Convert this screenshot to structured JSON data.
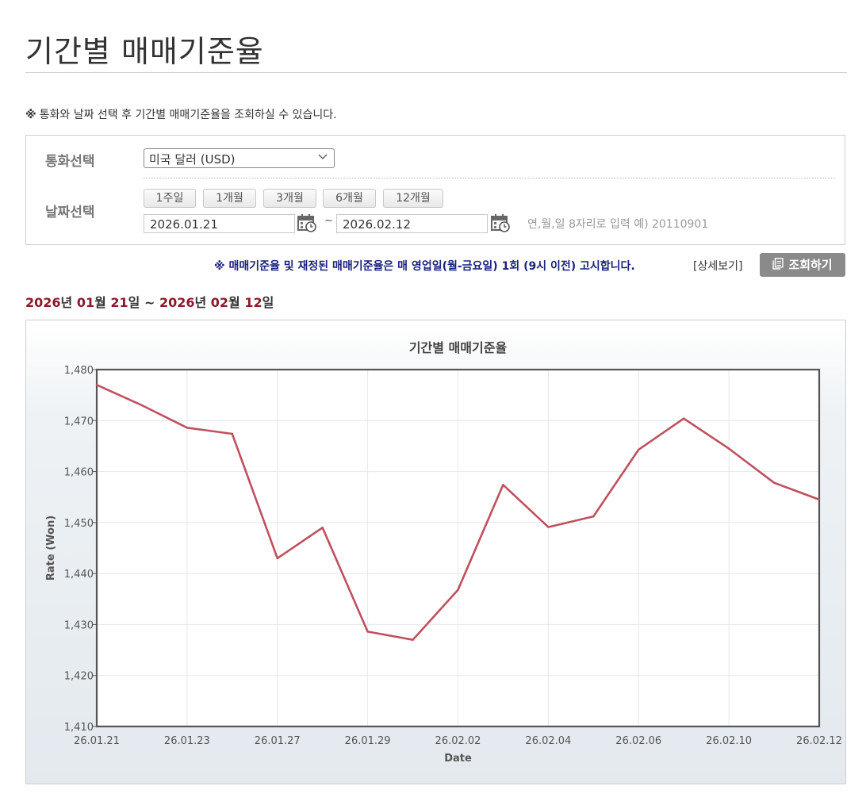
{
  "page": {
    "title": "기간별 매매기준율",
    "notice_mark": "※",
    "notice_text": "통화와 날짜 선택 후 기간별 매매기준율을 조회하실 수 있습니다."
  },
  "search": {
    "currency_label": "통화선택",
    "currency_selected": "미국 달러 (USD)",
    "date_label": "날짜선택",
    "period_buttons": [
      "1주일",
      "1개월",
      "3개월",
      "6개월",
      "12개월"
    ],
    "start_date": "2026.01.21",
    "end_date": "2026.02.12",
    "separator": "~",
    "date_hint": "연,월,일 8자리로 입력 예) 20110901"
  },
  "info": {
    "bold_notice": "※ 매매기준율 및 재정된 매매기준율은 매 영업일(월-금요일) 1회 (9시 이전) 고시합니다.",
    "detail_link": "[상세보기]",
    "search_button": "조회하기"
  },
  "range": {
    "start_year": "2026",
    "start_year_suffix": "년 ",
    "start_month": "01",
    "start_month_suffix": "월 ",
    "start_day": "21",
    "start_day_suffix": "일 ~ ",
    "end_year": "2026",
    "end_year_suffix": "년 ",
    "end_month": "02",
    "end_month_suffix": "월 ",
    "end_day": "12",
    "end_day_suffix": "일"
  },
  "colors": {
    "line": "#c0505e",
    "range_number": "#8b1a2b",
    "notice_blue": "#1a237e"
  },
  "chart_data": {
    "type": "line",
    "title": "기간별 매매기준율",
    "xlabel": "Date",
    "ylabel": "Rate (Won)",
    "ylim": [
      1410,
      1480
    ],
    "yticks": [
      "1,410",
      "1,420",
      "1,430",
      "1,440",
      "1,450",
      "1,460",
      "1,470",
      "1,480"
    ],
    "xtick_labels": [
      "26.01.21",
      "26.01.23",
      "26.01.27",
      "26.01.29",
      "26.02.02",
      "26.02.04",
      "26.02.06",
      "26.02.10",
      "26.02.12"
    ],
    "grid": true,
    "x": [
      "26.01.21",
      "26.01.22",
      "26.01.23",
      "26.01.26",
      "26.01.27",
      "26.01.28",
      "26.01.29",
      "26.01.30",
      "26.02.02",
      "26.02.03",
      "26.02.04",
      "26.02.05",
      "26.02.06",
      "26.02.09",
      "26.02.10",
      "26.02.11",
      "26.02.12"
    ],
    "values": [
      1477.0,
      1473.0,
      1468.6,
      1467.4,
      1443.0,
      1449.0,
      1428.6,
      1427.0,
      1436.8,
      1457.4,
      1449.1,
      1451.2,
      1464.3,
      1470.4,
      1464.5,
      1457.8,
      1454.5
    ]
  }
}
